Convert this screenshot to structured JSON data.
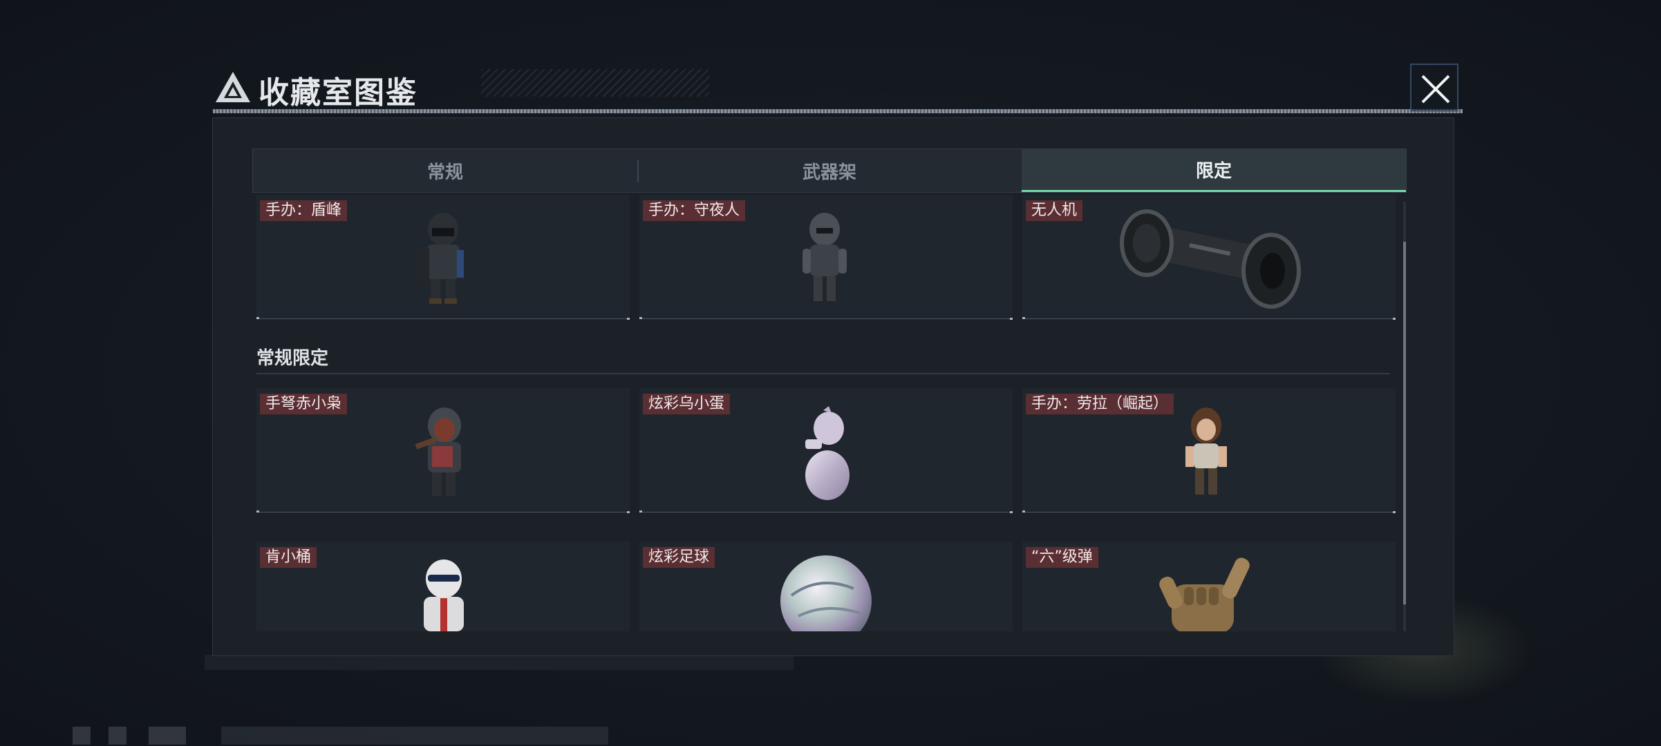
{
  "window": {
    "title": "收藏室图鉴",
    "close_icon": "close-icon"
  },
  "tabs": [
    {
      "label": "常规",
      "active": false
    },
    {
      "label": "武器架",
      "active": false
    },
    {
      "label": "限定",
      "active": true
    }
  ],
  "rows": {
    "top": [
      {
        "label": "手办：盾峰",
        "icon": "shield-soldier-figure-icon"
      },
      {
        "label": "手办：守夜人",
        "icon": "armored-nightwatch-figure-icon"
      },
      {
        "label": "无人机",
        "icon": "drone-roller-icon"
      }
    ],
    "section": {
      "title": "常规限定"
    },
    "middle": [
      {
        "label": "手弩赤小枭",
        "icon": "hooded-crossbow-figure-icon"
      },
      {
        "label": "炫彩乌小蛋",
        "icon": "iridescent-egg-creature-icon"
      },
      {
        "label": "手办：劳拉（崛起）",
        "icon": "lara-figure-icon"
      }
    ],
    "bottom": [
      {
        "label": "肯小桶",
        "icon": "white-mascot-figure-icon"
      },
      {
        "label": "炫彩足球",
        "icon": "iridescent-ball-icon"
      },
      {
        "label": "“六”级弹",
        "icon": "golden-hand-sign-icon"
      }
    ]
  },
  "colors": {
    "active_tab_accent": "#77d9a9",
    "tag_background": "#5a2f33",
    "panel_background": "#1c2128"
  }
}
